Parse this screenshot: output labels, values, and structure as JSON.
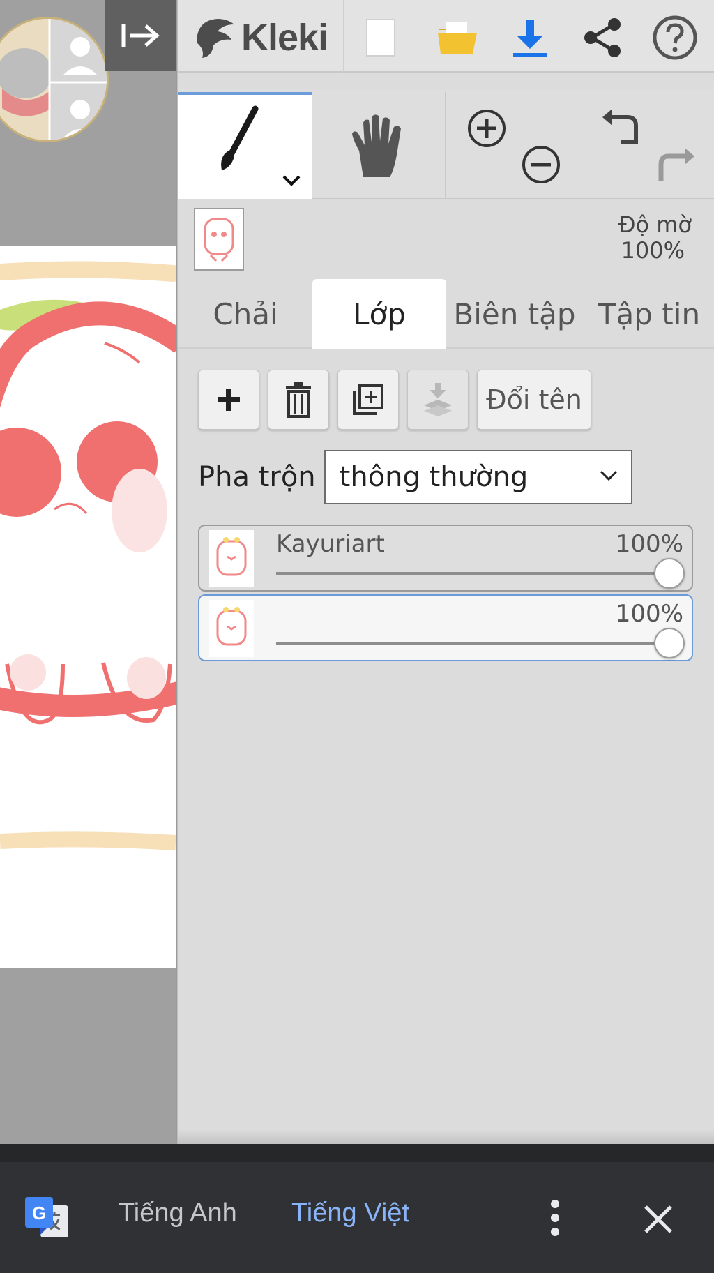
{
  "app": {
    "name": "Kleki"
  },
  "toolbar": {
    "icons": [
      "new-image-icon",
      "open-folder-icon",
      "download-icon",
      "share-icon",
      "help-icon"
    ]
  },
  "tools": {
    "brush": "brush-icon",
    "hand": "hand-icon",
    "zoom_in": "zoom-in-icon",
    "zoom_out": "zoom-out-icon",
    "undo": "undo-icon",
    "redo": "redo-icon"
  },
  "brush_settings": {
    "opacity_label": "Độ mờ",
    "opacity_value": "100%"
  },
  "tabs": [
    {
      "label": "Chải",
      "active": false
    },
    {
      "label": "Lớp",
      "active": true
    },
    {
      "label": "Biên tập",
      "active": false
    },
    {
      "label": "Tập tin",
      "active": false
    }
  ],
  "layer_actions": {
    "rename_label": "Đổi tên"
  },
  "blend": {
    "label": "Pha trộn",
    "value": "thông thường"
  },
  "layers": [
    {
      "name": "Kayuriart",
      "opacity": "100%",
      "opacity_fraction": 1.0,
      "selected": false
    },
    {
      "name": "",
      "opacity": "100%",
      "opacity_fraction": 1.0,
      "selected": true
    }
  ],
  "translate_bar": {
    "source_lang": "Tiếng Anh",
    "target_lang": "Tiếng Việt"
  },
  "colors": {
    "accent": "#6b9bd8",
    "download_blue": "#1a73e8",
    "folder_yellow": "#f2c230",
    "translate_active": "#8ab4f8",
    "strawberry_red": "#f07070"
  }
}
